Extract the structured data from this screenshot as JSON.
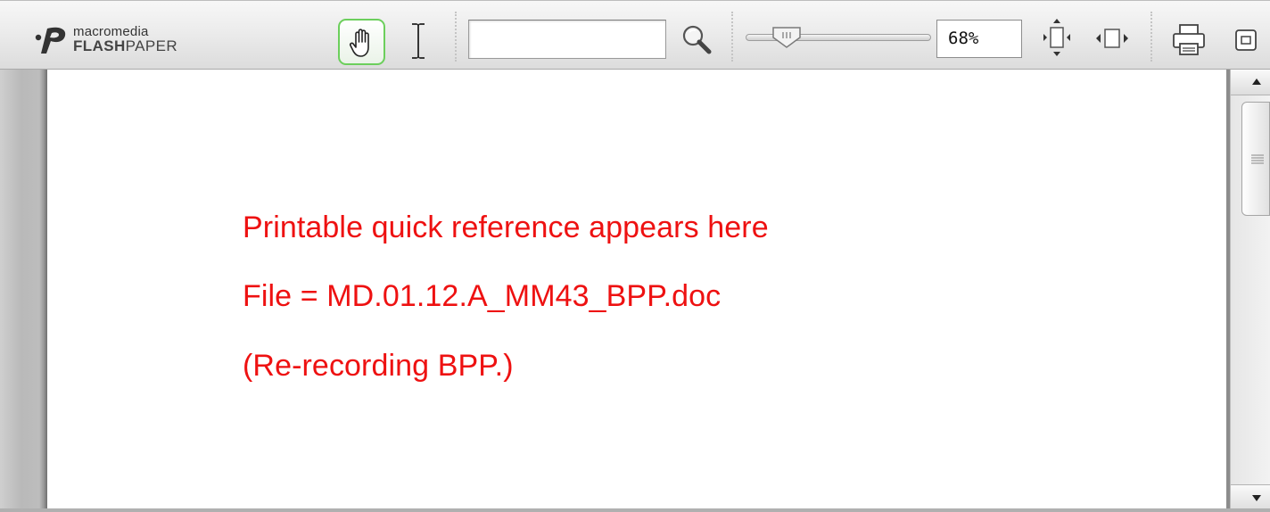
{
  "app": {
    "logo_top": "macromedia",
    "logo_bottom_bold": "FLASH",
    "logo_bottom_rest": "PAPER"
  },
  "toolbar": {
    "search_value": "",
    "zoom_value": "68%",
    "zoom_slider_level": 0.22,
    "active_tool": "hand",
    "icons": [
      "hand-icon",
      "text-select-icon",
      "search-icon",
      "fit-height-icon",
      "fit-width-icon",
      "print-icon",
      "fullscreen-icon"
    ],
    "accent_color": "#6ccf5c"
  },
  "document": {
    "text_color": "#ee1111",
    "lines": [
      "Printable quick reference appears here",
      "File = MD.01.12.A_MM43_BPP.doc",
      "(Re-recording BPP.)"
    ]
  }
}
